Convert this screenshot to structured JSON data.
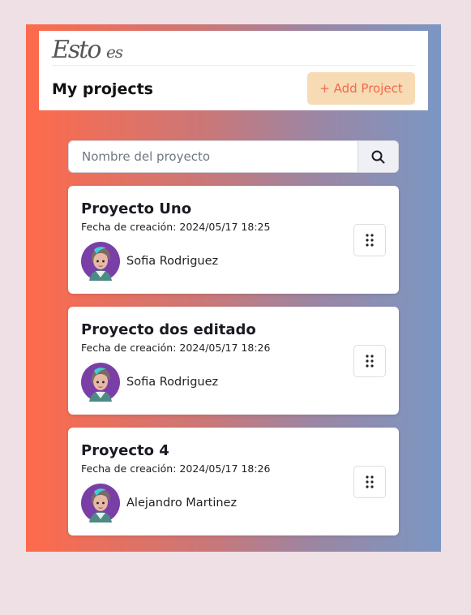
{
  "app": {
    "logo_main": "Esto",
    "logo_small": "es"
  },
  "header": {
    "title": "My projects",
    "add_button_label": "+ Add Project"
  },
  "search": {
    "placeholder": "Nombre del proyecto",
    "value": "",
    "button_icon": "search-icon"
  },
  "colors": {
    "gradient_start": "#ff6a4b",
    "gradient_end": "#7b97c3",
    "accent": "#f16a4c",
    "add_button_bg": "#f6dbb4",
    "avatar_bg": "#7a3fa6",
    "page_bg": "#efe0e5"
  },
  "projects": [
    {
      "title": "Proyecto Uno",
      "date_label": "Fecha de creación: 2024/05/17 18:25",
      "owner": "Sofia Rodriguez",
      "menu_icon": "drag-dots-icon"
    },
    {
      "title": "Proyecto dos editado",
      "date_label": "Fecha de creación: 2024/05/17 18:26",
      "owner": "Sofia Rodriguez",
      "menu_icon": "drag-dots-icon"
    },
    {
      "title": "Proyecto 4",
      "date_label": "Fecha de creación: 2024/05/17 18:26",
      "owner": "Alejandro Martinez",
      "menu_icon": "drag-dots-icon"
    }
  ]
}
